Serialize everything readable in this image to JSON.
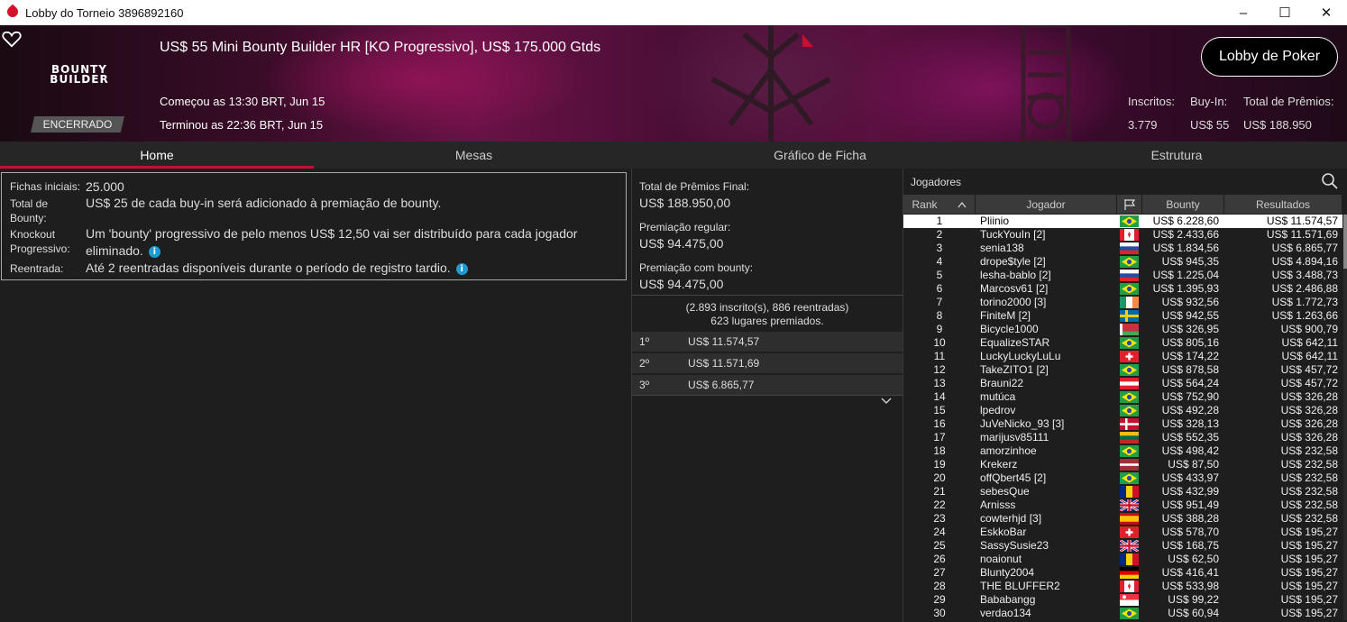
{
  "window": {
    "title": "Lobby do Torneio 3896892160",
    "controls": [
      "minimize",
      "maximize",
      "close"
    ]
  },
  "header": {
    "tournament_name": "US$ 55 Mini Bounty Builder HR [KO Progressivo], US$ 175.000 Gtds",
    "logo_line1": "BOUNTY",
    "logo_line2": "BUILDER",
    "started": "Começou as 13:30 BRT, Jun 15",
    "ended": "Terminou as 22:36 BRT, Jun 15",
    "status": "ENCERRADO",
    "lobby_button": "Lobby de Poker",
    "stats": {
      "entrants_label": "Inscritos:",
      "entrants_value": "3.779",
      "buyin_label": "Buy-In:",
      "buyin_value": "US$ 55",
      "total_label": "Total de Prêmios:",
      "total_value": "US$ 188.950"
    }
  },
  "tabs": [
    {
      "label": "Home",
      "active": true
    },
    {
      "label": "Mesas",
      "active": false
    },
    {
      "label": "Gráfico de Ficha",
      "active": false
    },
    {
      "label": "Estrutura",
      "active": false
    }
  ],
  "info": {
    "starting_chips_label": "Fichas iniciais:",
    "starting_chips_value": "25.000",
    "total_bounty_label_1": "Total de",
    "total_bounty_label_2": "Bounty:",
    "total_bounty_value": "US$ 25 de cada buy-in será adicionado à premiação de bounty.",
    "ko_label_1": "Knockout",
    "ko_label_2": "Progressivo:",
    "ko_value_1": "Um 'bounty' progressivo de pelo menos US$ 12,50 vai ser distribuído para cada jogador",
    "ko_value_2": "eliminado.",
    "reentry_label": "Reentrada:",
    "reentry_value": "Até 2 reentradas disponíveis durante o período de registro tardio."
  },
  "prizes": {
    "final_label": "Total de Prêmios Final:",
    "final_value": "US$ 188.950,00",
    "regular_label": "Premiação regular:",
    "regular_value": "US$ 94.475,00",
    "bounty_label": "Premiação com bounty:",
    "bounty_value": "US$ 94.475,00",
    "summary_1": "(2.893 inscrito(s), 886 reentradas)",
    "summary_2": "623 lugares premiados.",
    "places": [
      {
        "place": "1º",
        "amount": "US$ 11.574,57"
      },
      {
        "place": "2º",
        "amount": "US$ 11.571,69"
      },
      {
        "place": "3º",
        "amount": "US$ 6.865,77"
      }
    ]
  },
  "players": {
    "title": "Jogadores",
    "columns": {
      "rank": "Rank",
      "player": "Jogador",
      "bounty": "Bounty",
      "results": "Resultados"
    },
    "rows": [
      {
        "rank": "1",
        "name": "Pliinio",
        "flag": "br",
        "bounty": "US$ 6.228,60",
        "result": "US$ 11.574,57"
      },
      {
        "rank": "2",
        "name": "TuckYouIn [2]",
        "flag": "ca",
        "bounty": "US$ 2.433,66",
        "result": "US$ 11.571,69"
      },
      {
        "rank": "3",
        "name": "senia138",
        "flag": "si",
        "bounty": "US$ 1.834,56",
        "result": "US$ 6.865,77"
      },
      {
        "rank": "4",
        "name": "drope$tyle [2]",
        "flag": "br",
        "bounty": "US$ 945,35",
        "result": "US$ 4.894,16"
      },
      {
        "rank": "5",
        "name": "lesha-bablo [2]",
        "flag": "si",
        "bounty": "US$ 1.225,04",
        "result": "US$ 3.488,73"
      },
      {
        "rank": "6",
        "name": "Marcosv61 [2]",
        "flag": "br",
        "bounty": "US$ 1.395,93",
        "result": "US$ 2.486,88"
      },
      {
        "rank": "7",
        "name": "torino2000 [3]",
        "flag": "ie",
        "bounty": "US$ 932,56",
        "result": "US$ 1.772,73"
      },
      {
        "rank": "8",
        "name": "FiniteM [2]",
        "flag": "se",
        "bounty": "US$ 942,55",
        "result": "US$ 1.263,66"
      },
      {
        "rank": "9",
        "name": "Bicycle1000",
        "flag": "by",
        "bounty": "US$ 326,95",
        "result": "US$ 900,79"
      },
      {
        "rank": "10",
        "name": "EqualizeSTAR",
        "flag": "br",
        "bounty": "US$ 805,16",
        "result": "US$ 642,11"
      },
      {
        "rank": "11",
        "name": "LuckyLuckyLuLu",
        "flag": "ch",
        "bounty": "US$ 174,22",
        "result": "US$ 642,11"
      },
      {
        "rank": "12",
        "name": "TakeZITO1 [2]",
        "flag": "br",
        "bounty": "US$ 878,58",
        "result": "US$ 457,72"
      },
      {
        "rank": "13",
        "name": "Brauni22",
        "flag": "at",
        "bounty": "US$ 564,24",
        "result": "US$ 457,72"
      },
      {
        "rank": "14",
        "name": "mutúca",
        "flag": "br",
        "bounty": "US$ 752,90",
        "result": "US$ 326,28"
      },
      {
        "rank": "15",
        "name": "lpedrov",
        "flag": "br",
        "bounty": "US$ 492,28",
        "result": "US$ 326,28"
      },
      {
        "rank": "16",
        "name": "JuVeNicko_93 [3]",
        "flag": "dk",
        "bounty": "US$ 328,13",
        "result": "US$ 326,28"
      },
      {
        "rank": "17",
        "name": "marijusv85111",
        "flag": "lt",
        "bounty": "US$ 552,35",
        "result": "US$ 326,28"
      },
      {
        "rank": "18",
        "name": "amorzinhoe",
        "flag": "br",
        "bounty": "US$ 498,42",
        "result": "US$ 232,58"
      },
      {
        "rank": "19",
        "name": "Krekerz",
        "flag": "lv",
        "bounty": "US$ 87,50",
        "result": "US$ 232,58"
      },
      {
        "rank": "20",
        "name": "offQbert45 [2]",
        "flag": "br",
        "bounty": "US$ 433,97",
        "result": "US$ 232,58"
      },
      {
        "rank": "21",
        "name": "sebesQue",
        "flag": "ro",
        "bounty": "US$ 432,99",
        "result": "US$ 232,58"
      },
      {
        "rank": "22",
        "name": "Arnisss",
        "flag": "gb",
        "bounty": "US$ 951,49",
        "result": "US$ 232,58"
      },
      {
        "rank": "23",
        "name": "cowterhjd [3]",
        "flag": "es",
        "bounty": "US$ 388,28",
        "result": "US$ 232,58"
      },
      {
        "rank": "24",
        "name": "EskkoBar",
        "flag": "ch",
        "bounty": "US$ 578,70",
        "result": "US$ 195,27"
      },
      {
        "rank": "25",
        "name": "SassySusie23",
        "flag": "gb",
        "bounty": "US$ 168,75",
        "result": "US$ 195,27"
      },
      {
        "rank": "26",
        "name": "noaionut",
        "flag": "ro",
        "bounty": "US$ 62,50",
        "result": "US$ 195,27"
      },
      {
        "rank": "27",
        "name": "Blunty2004",
        "flag": "de",
        "bounty": "US$ 416,41",
        "result": "US$ 195,27"
      },
      {
        "rank": "28",
        "name": "THE BLUFFER2",
        "flag": "ca",
        "bounty": "US$ 533,98",
        "result": "US$ 195,27"
      },
      {
        "rank": "29",
        "name": "Bababangg",
        "flag": "sg",
        "bounty": "US$ 99,22",
        "result": "US$ 195,27"
      },
      {
        "rank": "30",
        "name": "verdao134",
        "flag": "br",
        "bounty": "US$ 60,94",
        "result": "US$ 195,27"
      }
    ]
  },
  "colors": {
    "accent": "#c8102e",
    "info_icon": "#1d9bd1",
    "background": "#1e1e1e"
  }
}
